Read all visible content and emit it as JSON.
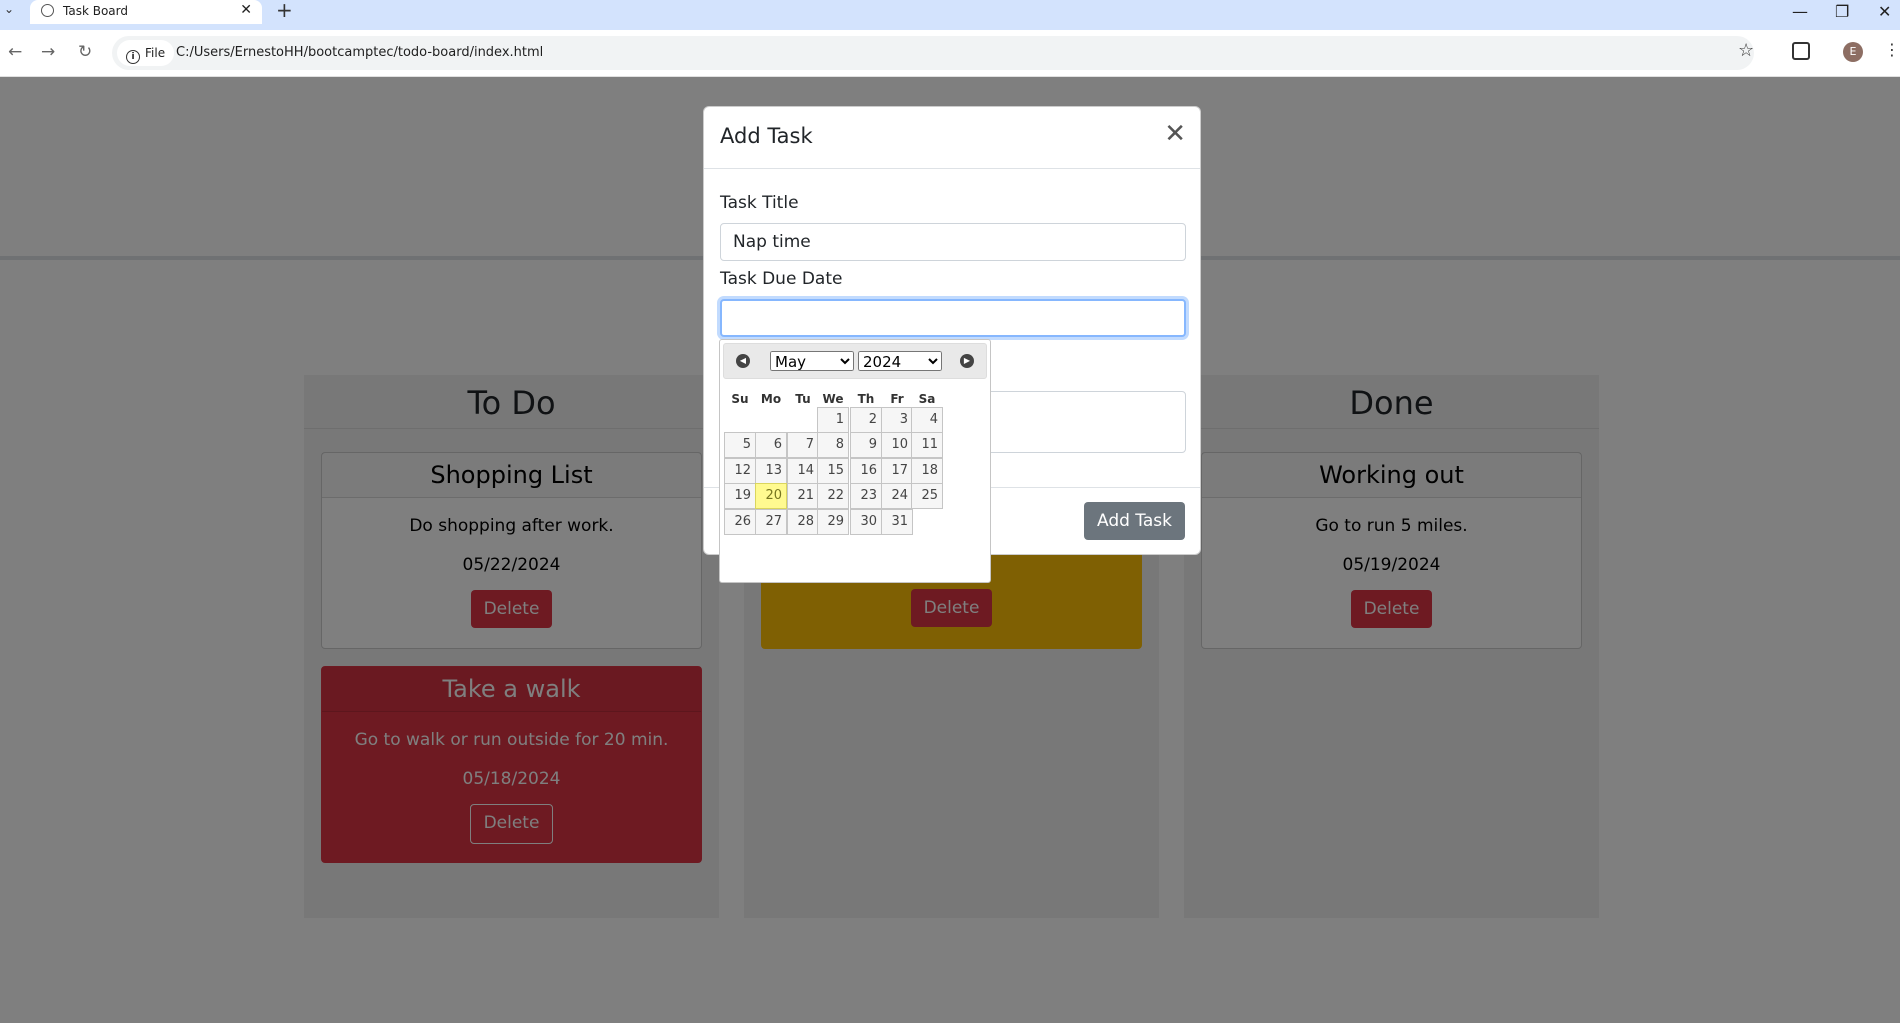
{
  "browser": {
    "tab_title": "Task Board",
    "chip_label": "File",
    "url": "C:/Users/ErnestoHH/bootcamptec/todo-board/index.html",
    "profile_initial": "E"
  },
  "lanes": {
    "todo_title": "To Do",
    "done_title": "Done"
  },
  "cards": {
    "todo": [
      {
        "title": "Shopping List",
        "description": "Do shopping after work.",
        "date": "05/22/2024",
        "delete_label": "Delete"
      },
      {
        "title": "Take a walk",
        "description": "Go to walk or run outside for 20 min.",
        "date": "05/18/2024",
        "delete_label": "Delete"
      }
    ],
    "in_progress": [
      {
        "delete_label": "Delete"
      }
    ],
    "done": [
      {
        "title": "Working out",
        "description": "Go to run 5 miles.",
        "date": "05/19/2024",
        "delete_label": "Delete"
      }
    ]
  },
  "modal": {
    "title": "Add Task",
    "task_title_label": "Task Title",
    "task_title_value": "Nap time",
    "due_date_label": "Task Due Date",
    "due_date_value": "",
    "add_button": "Add Task"
  },
  "datepicker": {
    "month": "May",
    "year": "2024",
    "weekdays": [
      "Su",
      "Mo",
      "Tu",
      "We",
      "Th",
      "Fr",
      "Sa"
    ],
    "days": [
      "1",
      "2",
      "3",
      "4",
      "5",
      "6",
      "7",
      "8",
      "9",
      "10",
      "11",
      "12",
      "13",
      "14",
      "15",
      "16",
      "17",
      "18",
      "19",
      "20",
      "21",
      "22",
      "23",
      "24",
      "25",
      "26",
      "27",
      "28",
      "29",
      "30",
      "31"
    ],
    "today": "20"
  },
  "colors": {
    "danger": "#dc3545",
    "warning": "#ffc107",
    "secondary": "#6c757d",
    "highlight": "#fffa90"
  }
}
